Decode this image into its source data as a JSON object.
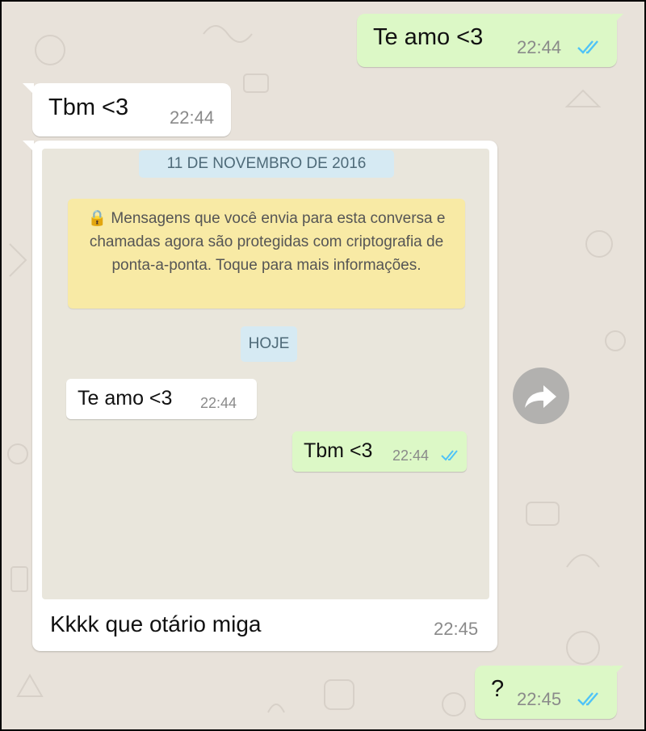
{
  "messages": [
    {
      "id": "m1",
      "direction": "outgoing",
      "text": "Te amo <3",
      "time": "22:44",
      "status": "read"
    },
    {
      "id": "m2",
      "direction": "incoming",
      "text": "Tbm <3",
      "time": "22:44"
    },
    {
      "id": "m3",
      "direction": "incoming",
      "type": "image",
      "caption": "Kkkk que otário miga",
      "time": "22:45"
    },
    {
      "id": "m4",
      "direction": "outgoing",
      "text": "?",
      "time": "22:45",
      "status": "read"
    }
  ],
  "screenshot": {
    "date_chip": "11 DE NOVEMBRO DE 2016",
    "encryption_notice": "🔒 Mensagens que você envia para esta conversa e chamadas agora são protegidas com criptografia de ponta-a-ponta. Toque para mais informações.",
    "today_chip": "HOJE",
    "messages": [
      {
        "direction": "incoming",
        "text": "Te amo <3",
        "time": "22:44"
      },
      {
        "direction": "outgoing",
        "text": "Tbm <3",
        "time": "22:44",
        "status": "read"
      }
    ]
  },
  "icons": {
    "read_receipt": "double-check-icon",
    "forward": "forward-arrow-icon",
    "lock": "lock-icon"
  },
  "colors": {
    "outgoing_bubble": "#dcf8c6",
    "incoming_bubble": "#ffffff",
    "chat_background": "#e8e2da",
    "read_ticks": "#4fc3f7",
    "notice_background": "#f8eaa5",
    "date_chip_background": "#d6eaf3"
  }
}
